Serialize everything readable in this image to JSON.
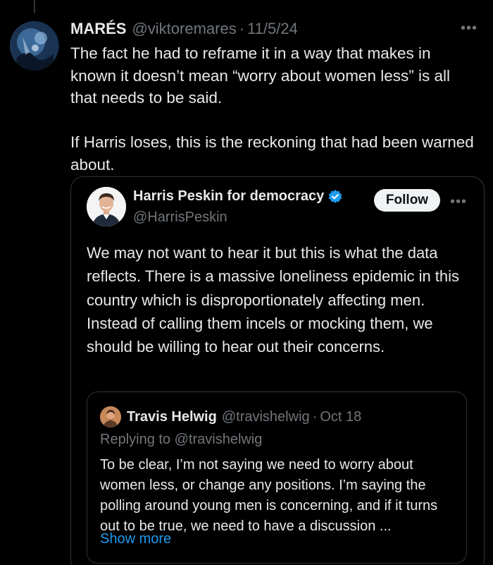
{
  "tweet": {
    "author_name": "MARÉS",
    "author_handle": "@viktoremares",
    "separator": "·",
    "date": "11/5/24",
    "more_icon": "more-horizontal-icon",
    "paragraphs": [
      "The fact he had to reframe it in a way that makes in known it doesn’t mean  “worry about women less” is all that needs to be said.",
      "If Harris loses, this is the reckoning that had been warned about."
    ]
  },
  "quote": {
    "author_name": "Harris Peskin for democracy",
    "verified_icon": "verified-badge-icon",
    "author_handle": "@HarrisPeskin",
    "follow_label": "Follow",
    "text": "We may not want to hear it but this is what the data reflects. There is a massive loneliness epidemic in this country which is disproportionately affecting men. Instead of calling them incels or mocking them, we should be willing to hear out their concerns."
  },
  "nested_quote": {
    "author_name": "Travis Helwig",
    "author_handle": "@travishelwig",
    "separator": "·",
    "date": "Oct 18",
    "replying_prefix": "Replying to",
    "replying_to": "@travishelwig",
    "text": "To be clear, I’m not saying we need to worry about women less, or change any positions. I’m saying the polling around young men is concerning, and if it turns out to be true, we need to have a discussion ...",
    "show_more_label": "Show more"
  },
  "colors": {
    "background": "#000000",
    "text": "#e7e9ea",
    "secondary": "#71767b",
    "accent": "#1d9bf0",
    "border": "#2f3336"
  }
}
